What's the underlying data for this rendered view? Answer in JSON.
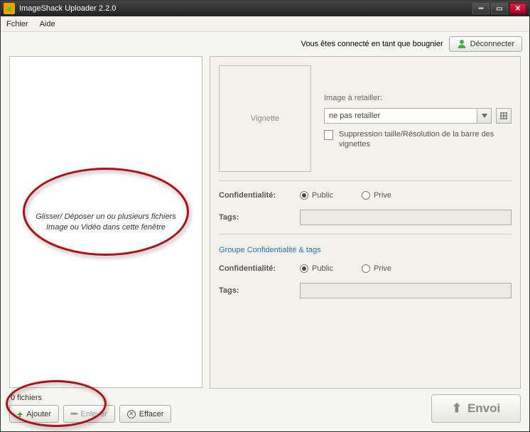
{
  "window": {
    "title": "ImageShack Uploader 2.2.0"
  },
  "menu": {
    "file": "Fchier",
    "help": "Aide"
  },
  "status": {
    "text": "Vous êtes connecté en tant que bougnier",
    "disconnect": "Déconnecter"
  },
  "dropzone": {
    "line1": "Glisser/ Déposer un ou plusieurs fichiers",
    "line2": "Image ou Vidéo dans cette fenêtre"
  },
  "files": {
    "count_label": "0 fichiers",
    "add": "Ajouter",
    "remove": "Enlever",
    "clear": "Effacer"
  },
  "panel": {
    "thumbnail": "Vignette",
    "resize_label": "Image à  retailler:",
    "resize_value": "ne pas retailler",
    "suppress_label": "Suppression taille/Résolution de la barre des vignettes",
    "confidentiality": "Confidentialité:",
    "public": "Public",
    "private": "Prive",
    "tags": "Tags:",
    "group_link": "Groupe Confidentialité & tags"
  },
  "send": {
    "label": "Envoi"
  }
}
